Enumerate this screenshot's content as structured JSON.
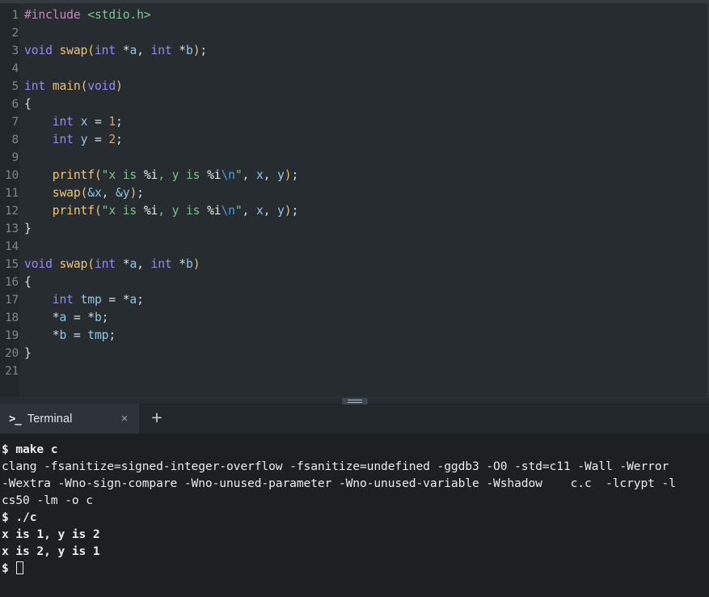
{
  "editor": {
    "language": "c",
    "line_numbers": [
      1,
      2,
      3,
      4,
      5,
      6,
      7,
      8,
      9,
      10,
      11,
      12,
      13,
      14,
      15,
      16,
      17,
      18,
      19,
      20,
      21
    ],
    "lines": [
      {
        "n": 1,
        "text": "#include <stdio.h>"
      },
      {
        "n": 2,
        "text": ""
      },
      {
        "n": 3,
        "text": "void swap(int *a, int *b);"
      },
      {
        "n": 4,
        "text": ""
      },
      {
        "n": 5,
        "text": "int main(void)"
      },
      {
        "n": 6,
        "text": "{"
      },
      {
        "n": 7,
        "text": "    int x = 1;"
      },
      {
        "n": 8,
        "text": "    int y = 2;"
      },
      {
        "n": 9,
        "text": ""
      },
      {
        "n": 10,
        "text": "    printf(\"x is %i, y is %i\\n\", x, y);"
      },
      {
        "n": 11,
        "text": "    swap(&x, &y);"
      },
      {
        "n": 12,
        "text": "    printf(\"x is %i, y is %i\\n\", x, y);"
      },
      {
        "n": 13,
        "text": "}"
      },
      {
        "n": 14,
        "text": ""
      },
      {
        "n": 15,
        "text": "void swap(int *a, int *b)"
      },
      {
        "n": 16,
        "text": "{"
      },
      {
        "n": 17,
        "text": "    int tmp = *a;"
      },
      {
        "n": 18,
        "text": "    *a = *b;"
      },
      {
        "n": 19,
        "text": "    *b = tmp;"
      },
      {
        "n": 20,
        "text": "}"
      },
      {
        "n": 21,
        "text": ""
      }
    ]
  },
  "panel": {
    "tab": {
      "icon": "prompt-icon",
      "label": "Terminal",
      "close_label": "×"
    },
    "add_tab_label": "+"
  },
  "terminal": {
    "lines": [
      "$ make c",
      "clang -fsanitize=signed-integer-overflow -fsanitize=undefined -ggdb3 -O0 -std=c11 -Wall -Werror",
      "-Wextra -Wno-sign-compare -Wno-unused-parameter -Wno-unused-variable -Wshadow    c.c  -lcrypt -l",
      "cs50 -lm -o c",
      "$ ./c",
      "x is 1, y is 2",
      "x is 2, y is 1"
    ],
    "final_prompt": "$ "
  },
  "colors": {
    "editor_bg": "#272c30",
    "gutter_bg": "#22272b",
    "terminal_bg": "#1d2021",
    "tabbar_bg": "#22272b",
    "active_tab_bg": "#2d3339",
    "keyword": "#9a86fb",
    "function": "#e5c07b",
    "string": "#7fc08a",
    "number": "#e09b63",
    "preprocessor": "#c586c0",
    "variable": "#8ec7e8",
    "escape": "#4a9de0",
    "foreground": "#d7dde3"
  }
}
